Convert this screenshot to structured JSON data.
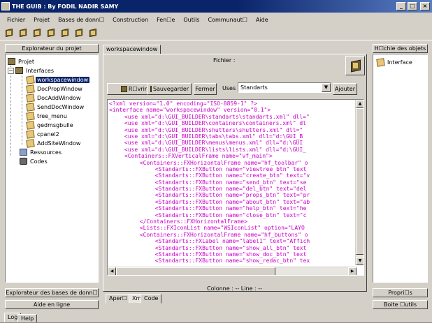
{
  "window": {
    "title": "THE GUIB : By FODIL NADIR SAMY",
    "minimize": "_",
    "maximize": "□",
    "close": "×"
  },
  "menu": [
    "Fichier",
    "Projet",
    "Bases de donn☐",
    "Construction",
    "Fen☐e",
    "Outils",
    "Communaut☐",
    "Aide"
  ],
  "toolbar_icons": [
    "cube-icon",
    "cube-icon",
    "cube-icon",
    "cube-icon",
    "cube-icon",
    "cube-icon",
    "cube-icon"
  ],
  "left_panel": {
    "header": "Explorateur du projet",
    "tree": {
      "root": "Projet",
      "interfaces": "Interfaces",
      "interface_items": [
        "workspacewindow",
        "DocPropWindow",
        "DocAddWindow",
        "SendDocWindow",
        "tree_menu",
        "gedmsgbulle",
        "cpanel2",
        "AddSiteWindow"
      ],
      "selected": "workspacewindow",
      "resources": "Ressources",
      "codes": "Codes"
    },
    "db_explorer_btn": "Explorateur des bases de donn☐",
    "help_btn": "Aide en ligne"
  },
  "center": {
    "tab": "workspacewindow",
    "file_label": "Fichier :",
    "buttons": {
      "open": "R☐vrir",
      "save": "Sauvegarder",
      "close": "Fermer"
    },
    "uses_label": "Uses",
    "uses_value": "Standarts",
    "add_btn": "Ajouter",
    "status": "Colonne : -- Line : --",
    "bottom_tabs": [
      "Aper☐",
      "Xml",
      "Code"
    ]
  },
  "code": [
    {
      "text": "<?xml version=\"1.0\" encoding=\"ISO-8859-1\" ?>",
      "color": "#cc00cc",
      "indent": 0
    },
    {
      "text": "<interface name=\"workspacewindow\" version=\"0.1\">",
      "color": "#cc00cc",
      "indent": 0
    },
    {
      "text": "<use xml=\"d:\\GUI_BUILDER\\standarts\\standarts.xml\" dll=\"",
      "color": "#cc00cc",
      "indent": 3
    },
    {
      "text": "<use xml=\"d:\\GUI_BUILDER\\containers\\containers.xml\" dl",
      "color": "#cc00cc",
      "indent": 3
    },
    {
      "text": "<use xml=\"d:\\GUI_BUILDER\\shutters\\shutters.xml\" dll=\"",
      "color": "#cc00cc",
      "indent": 3
    },
    {
      "text": "<use xml=\"d:\\GUI_BUILDER\\tabs\\tabs.xml\" dll=\"d:\\GUI_B",
      "color": "#cc00cc",
      "indent": 3
    },
    {
      "text": "<use xml=\"d:\\GUI_BUILDER\\menus\\menus.xml\" dll=\"d:\\GUI",
      "color": "#cc00cc",
      "indent": 3
    },
    {
      "text": "<use xml=\"d:\\GUI_BUILDER\\lists\\lists.xml\" dll=\"d:\\GUI_",
      "color": "#cc00cc",
      "indent": 3
    },
    {
      "text": "<Containers::FXVerticalFrame name=\"vf_main\">",
      "color": "#cc00cc",
      "indent": 3
    },
    {
      "text": "<Containers::FXHorizontalFrame name=\"hf_toolbar\" o",
      "color": "#cc00cc",
      "indent": 6
    },
    {
      "text": "<Standarts::FXButton name=\"viewtree_btn\" text",
      "color": "#cc00cc",
      "indent": 9
    },
    {
      "text": "<Standarts::FXButton name=\"create_btn\" text=\"v",
      "color": "#cc00cc",
      "indent": 9
    },
    {
      "text": "<Standarts::FXButton name=\"send_btn\" text=\"se",
      "color": "#cc00cc",
      "indent": 9
    },
    {
      "text": "<Standarts::FXButton name=\"del_btn\" text=\"del",
      "color": "#cc00cc",
      "indent": 9
    },
    {
      "text": "<Standarts::FXButton name=\"props_btn\" text=\"pr",
      "color": "#cc00cc",
      "indent": 9
    },
    {
      "text": "<Standarts::FXButton name=\"about_btn\" text=\"ab",
      "color": "#cc00cc",
      "indent": 9
    },
    {
      "text": "<Standarts::FXButton name=\"help_btn\" text=\"he",
      "color": "#cc00cc",
      "indent": 9
    },
    {
      "text": "<Standarts::FXButton name=\"close_btn\" text=\"c",
      "color": "#cc00cc",
      "indent": 9
    },
    {
      "text": "</Containers::FXHorizontalFrame>",
      "color": "#cc00cc",
      "indent": 6
    },
    {
      "text": "<Lists::FXIconList name=\"WSIconList\" option=\"LAYO",
      "color": "#cc00cc",
      "indent": 6
    },
    {
      "text": "<Containers::FXHorizontalFrame name=\"hf_buttons\" o",
      "color": "#cc00cc",
      "indent": 6
    },
    {
      "text": "<Standarts::FXLabel name=\"label1\" text=\"Affich",
      "color": "#cc00cc",
      "indent": 9
    },
    {
      "text": "<Standarts::FXButton name=\"show_all_btn\" text",
      "color": "#cc00cc",
      "indent": 9
    },
    {
      "text": "<Standarts::FXButton name=\"show_doc_btn\" text",
      "color": "#cc00cc",
      "indent": 9
    },
    {
      "text": "<Standarts::FXButton name=\"show_redac_btn\" tex",
      "color": "#cc00cc",
      "indent": 9
    }
  ],
  "right_panel": {
    "header": "H☐chie des objets",
    "item": "Interface",
    "props_btn": "Propri☐s",
    "toolbox_btn": "Boite ☐utils"
  },
  "bottom": {
    "tabs": [
      "Log",
      "Help"
    ]
  }
}
